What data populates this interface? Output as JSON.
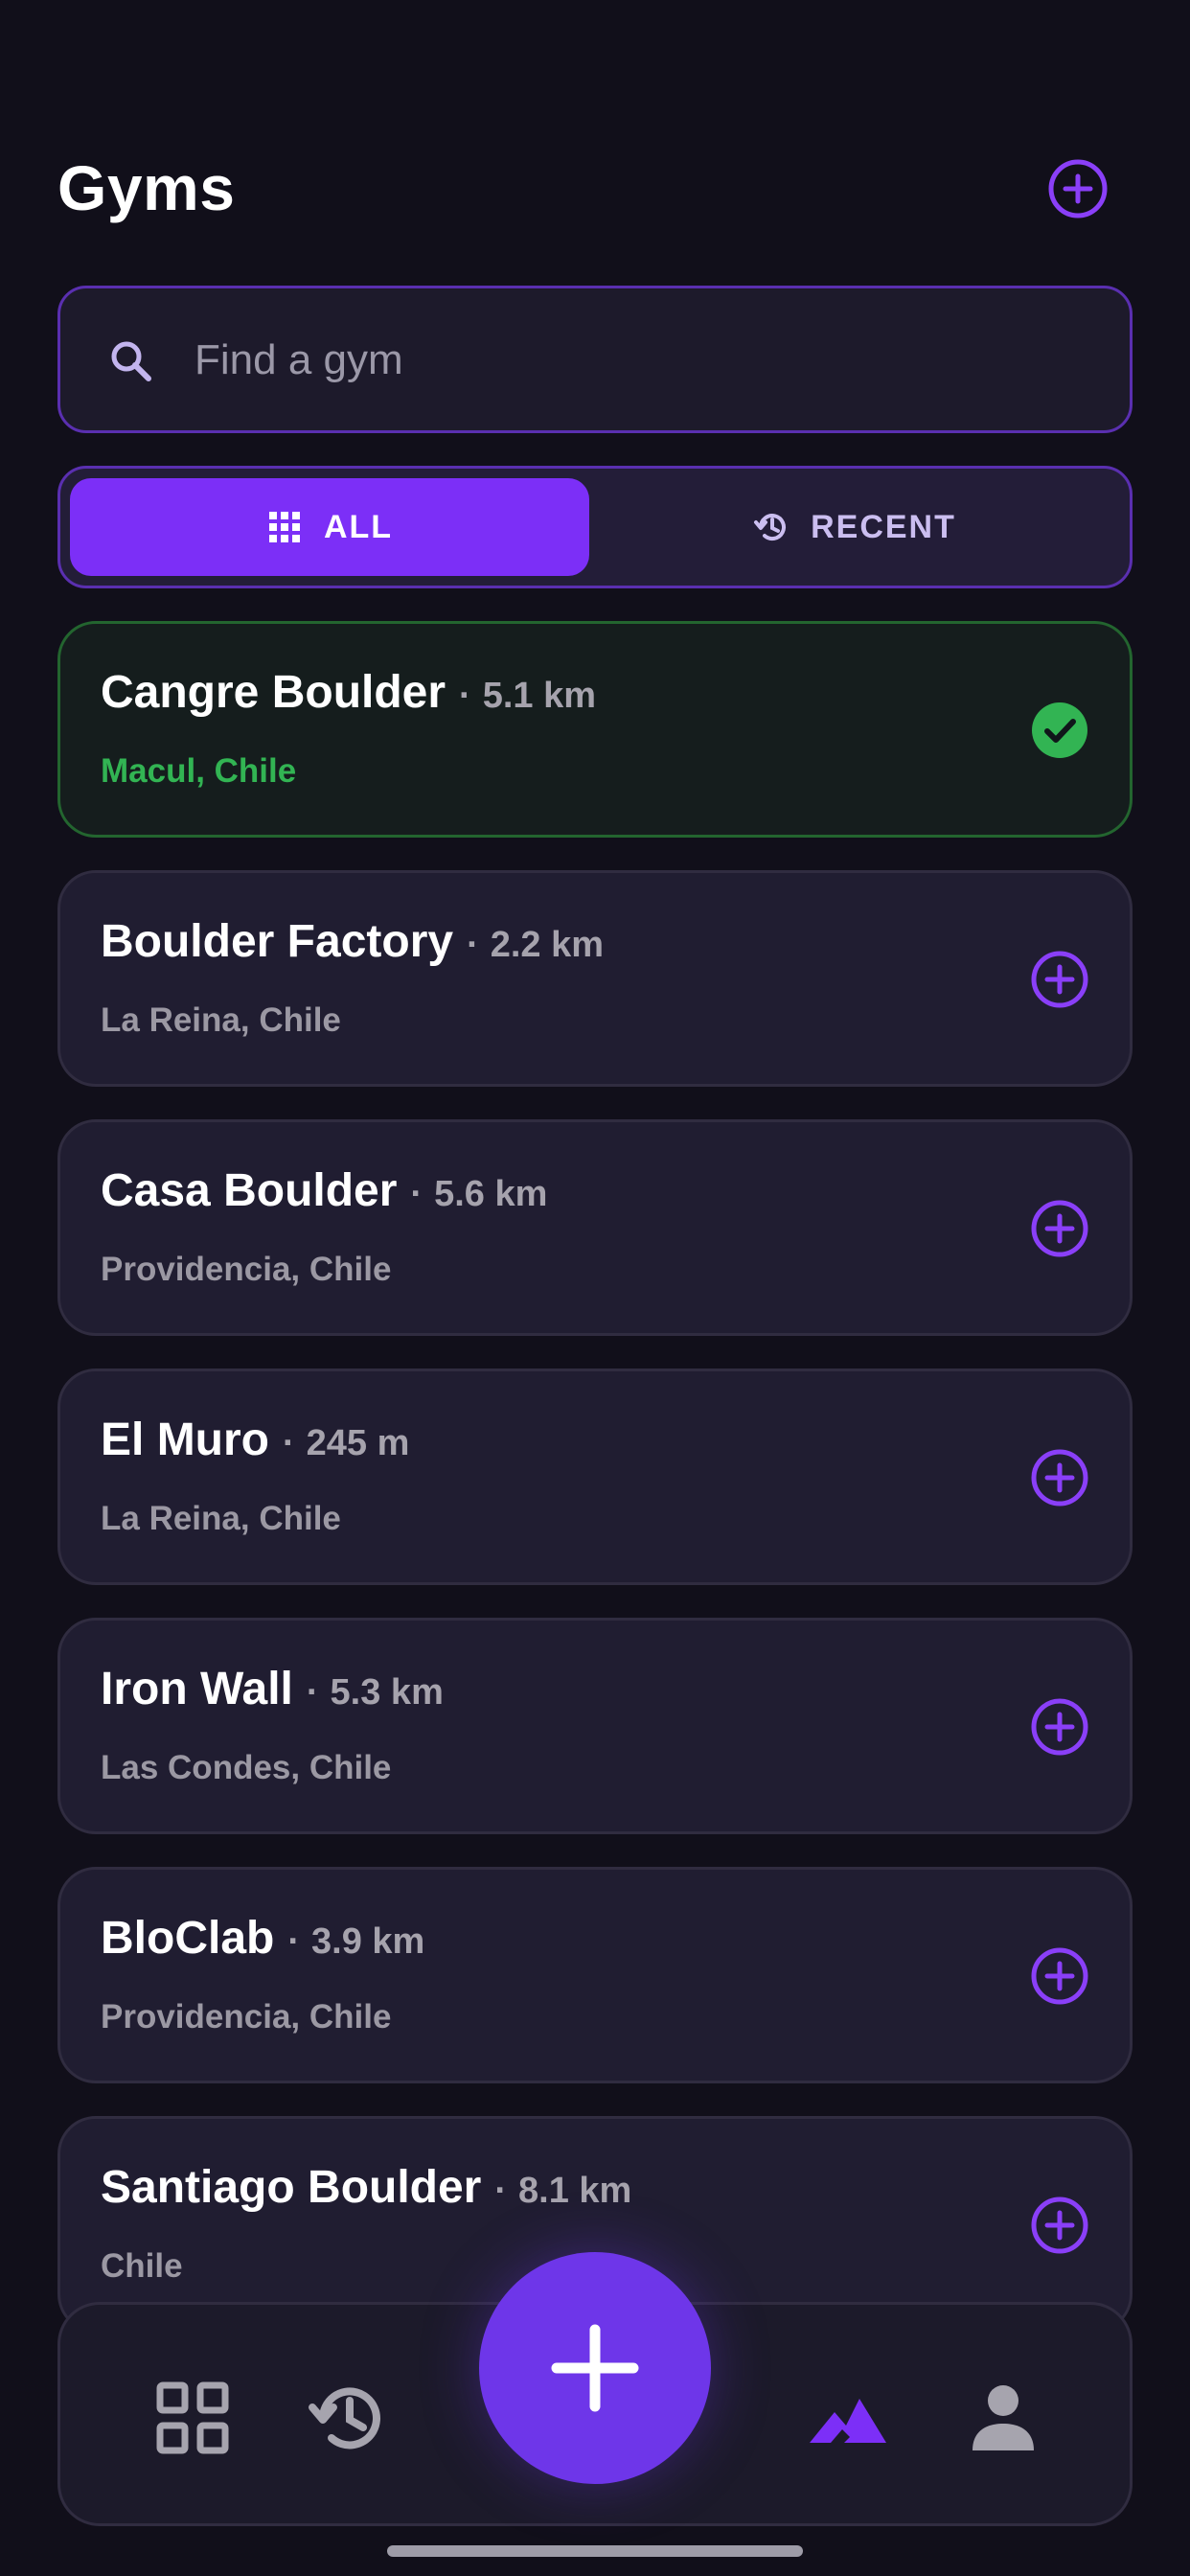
{
  "header": {
    "title": "Gyms",
    "add_icon": "plus-circle-icon"
  },
  "search": {
    "placeholder": "Find a gym",
    "value": "",
    "icon": "search-icon"
  },
  "tabs": [
    {
      "label": "ALL",
      "icon": "grid-icon",
      "active": true
    },
    {
      "label": "RECENT",
      "icon": "history-icon",
      "active": false
    }
  ],
  "gyms": [
    {
      "name": "Cangre Boulder",
      "distance": "5.1 km",
      "location": "Macul, Chile",
      "selected": true
    },
    {
      "name": "Boulder Factory",
      "distance": "2.2 km",
      "location": "La Reina, Chile",
      "selected": false
    },
    {
      "name": "Casa Boulder",
      "distance": "5.6 km",
      "location": "Providencia, Chile",
      "selected": false
    },
    {
      "name": "El Muro",
      "distance": "245 m",
      "location": "La Reina, Chile",
      "selected": false
    },
    {
      "name": "Iron Wall",
      "distance": "5.3 km",
      "location": "Las Condes, Chile",
      "selected": false
    },
    {
      "name": "BloClab",
      "distance": "3.9 km",
      "location": "Providencia, Chile",
      "selected": false
    },
    {
      "name": "Santiago Boulder",
      "distance": "8.1 km",
      "location": "Chile",
      "selected": false
    }
  ],
  "bottom_nav": {
    "items": [
      "grid-icon",
      "history-icon",
      "plus-icon",
      "mountain-icon",
      "person-icon"
    ],
    "active": "mountain-icon"
  },
  "colors": {
    "background": "#110f1a",
    "accent": "#7c2ff7",
    "selected_green": "#32b453",
    "card": "#201d31"
  }
}
